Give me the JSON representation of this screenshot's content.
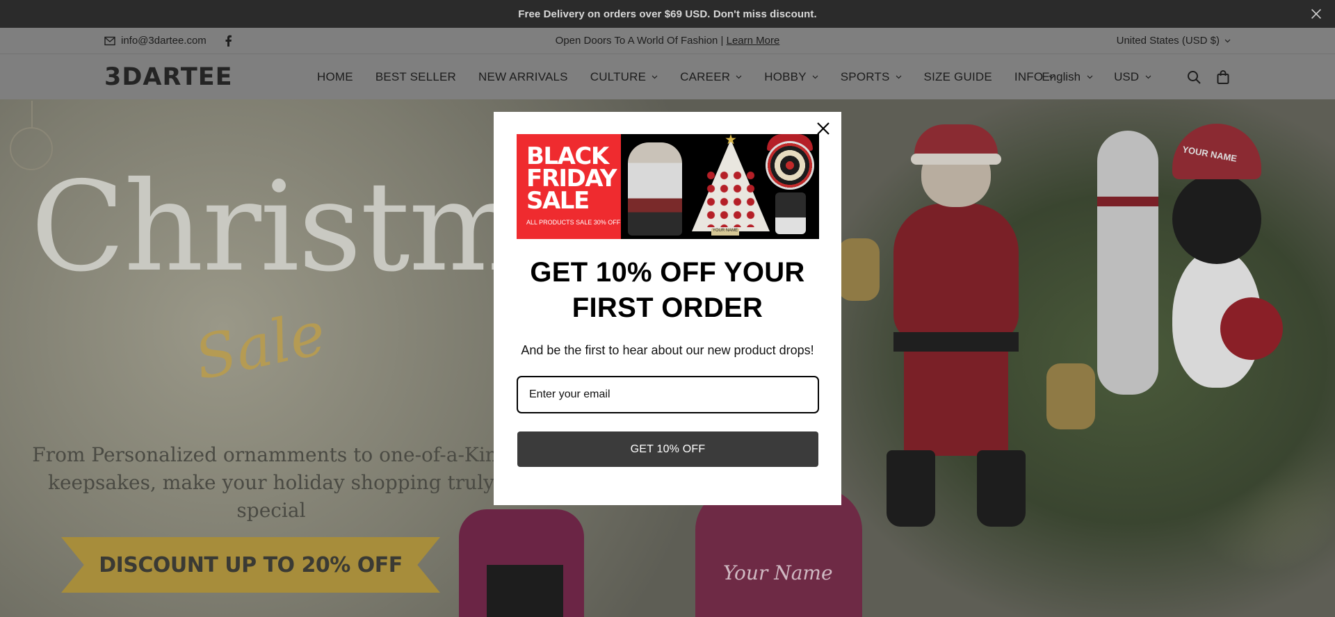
{
  "announcement": {
    "text": "Free Delivery on orders over $69 USD. Don't miss discount.",
    "close_icon": "close-icon"
  },
  "utility": {
    "email": "info@3dartee.com",
    "promo_text": "Open Doors To A World Of Fashion | ",
    "promo_link": "Learn More",
    "country": "United States (USD $)"
  },
  "header": {
    "logo": "3DARTEE",
    "nav": [
      {
        "label": "HOME",
        "dropdown": false
      },
      {
        "label": "BEST SELLER",
        "dropdown": false
      },
      {
        "label": "NEW ARRIVALS",
        "dropdown": false
      },
      {
        "label": "CULTURE",
        "dropdown": true
      },
      {
        "label": "CAREER",
        "dropdown": true
      },
      {
        "label": "HOBBY",
        "dropdown": true
      },
      {
        "label": "SPORTS",
        "dropdown": true
      },
      {
        "label": "SIZE GUIDE",
        "dropdown": false
      },
      {
        "label": "INFO",
        "dropdown": true
      }
    ],
    "language": "English",
    "currency": "USD"
  },
  "hero": {
    "title": "Christmas",
    "script": "Sale",
    "subtitle_line1": "From Personalized ornamments to one-of-a-Kind",
    "subtitle_line2": "keepsakes, make your holiday shopping truly special",
    "ribbon": "DISCOUNT UP TO 20% OFF",
    "bag_text": "Your Name",
    "penguin_hat_text": "YOUR NAME"
  },
  "popup": {
    "banner_title_1": "BLACK",
    "banner_title_2": "FRIDAY",
    "banner_title_3": "SALE",
    "banner_small": "ALL PRODUCTS SALE 30% OFF",
    "banner_tag": "YOUR NAME",
    "heading_line1": "GET 10% OFF YOUR",
    "heading_line2": "FIRST ORDER",
    "description": "And be the first to hear about our new product drops!",
    "email_placeholder": "Enter your email",
    "button": "GET 10% OFF"
  },
  "colors": {
    "announcement_bg": "#2b2b2b",
    "header_bg_dimmed": "#7f7f7f",
    "popup_button": "#3b3b3b",
    "banner_red": "#ef2b2f"
  }
}
